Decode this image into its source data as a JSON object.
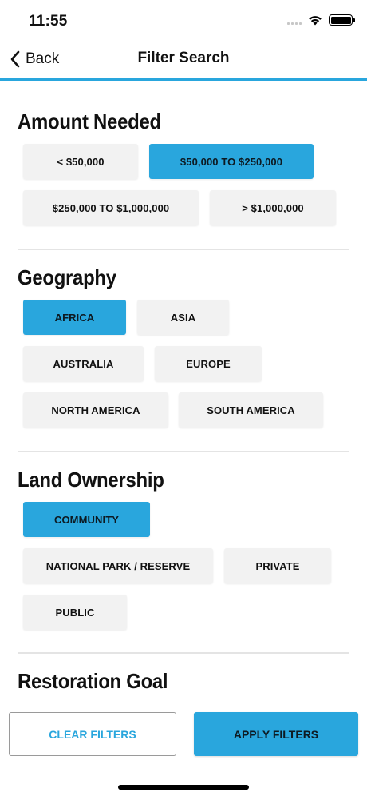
{
  "status_bar": {
    "time": "11:55"
  },
  "nav": {
    "back_label": "Back",
    "title": "Filter Search"
  },
  "sections": [
    {
      "title": "Amount Needed",
      "options": [
        {
          "label": "< $50,000",
          "selected": false
        },
        {
          "label": "$50,000 TO $250,000",
          "selected": true
        },
        {
          "label": "$250,000 TO $1,000,000",
          "selected": false
        },
        {
          "label": "> $1,000,000",
          "selected": false
        }
      ]
    },
    {
      "title": "Geography",
      "options": [
        {
          "label": "AFRICA",
          "selected": true
        },
        {
          "label": "ASIA",
          "selected": false
        },
        {
          "label": "AUSTRALIA",
          "selected": false
        },
        {
          "label": "EUROPE",
          "selected": false
        },
        {
          "label": "NORTH AMERICA",
          "selected": false
        },
        {
          "label": "SOUTH AMERICA",
          "selected": false
        }
      ]
    },
    {
      "title": "Land Ownership",
      "options": [
        {
          "label": "COMMUNITY",
          "selected": true
        },
        {
          "label": "NATIONAL PARK / RESERVE",
          "selected": false
        },
        {
          "label": "PRIVATE",
          "selected": false
        },
        {
          "label": "PUBLIC",
          "selected": false
        }
      ]
    },
    {
      "title": "Restoration Goal",
      "options": []
    }
  ],
  "footer": {
    "clear_label": "CLEAR FILTERS",
    "apply_label": "APPLY FILTERS"
  },
  "colors": {
    "accent": "#29a6dd",
    "chip": "#f2f2f2"
  }
}
